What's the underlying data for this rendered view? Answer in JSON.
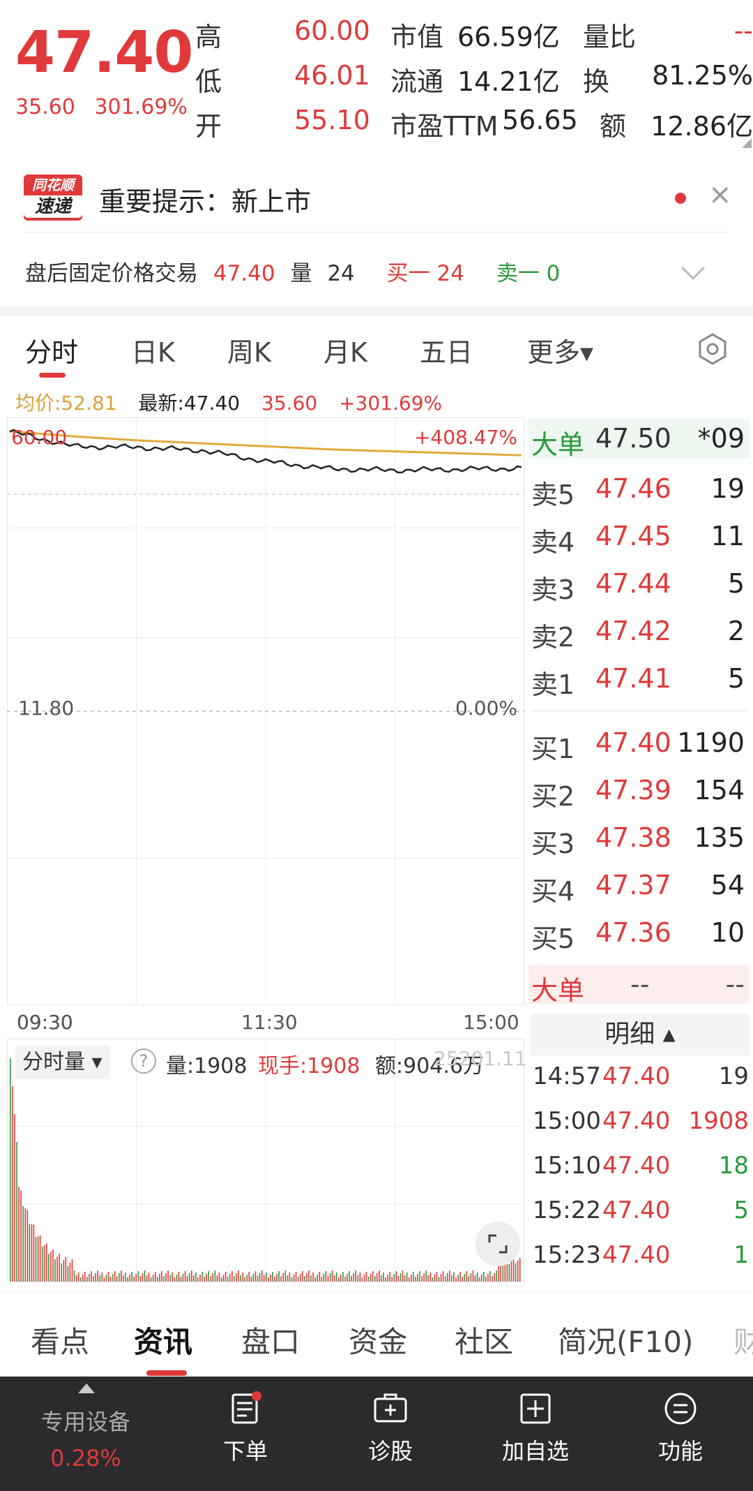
{
  "quote": {
    "price": "47.40",
    "change": "35.60",
    "change_pct": "301.69%",
    "rows": [
      {
        "l1": "高",
        "v1": "60.00",
        "l2": "市值",
        "v2": "66.59亿",
        "l3": "量比",
        "v3": "--"
      },
      {
        "l1": "低",
        "v1": "46.01",
        "l2": "流通",
        "v2": "14.21亿",
        "l3": "换",
        "v3": "81.25%"
      },
      {
        "l1": "开",
        "v1": "55.10",
        "l2": "市盈TTM",
        "v2": "56.65",
        "l3": "额",
        "v3": "12.86亿"
      }
    ]
  },
  "notice": {
    "logo_top": "同花顺",
    "logo_bottom": "速递",
    "text": "重要提示：新上市"
  },
  "after_hours": {
    "label": "盘后固定价格交易",
    "price": "47.40",
    "vol_label": "量",
    "vol": "24",
    "buy1": "买一 24",
    "sell1": "卖一 0"
  },
  "tabs": [
    "分时",
    "日K",
    "周K",
    "月K",
    "五日",
    "更多▾"
  ],
  "stats": {
    "avg": "均价:52.81",
    "latest": "最新:47.40",
    "change": "35.60",
    "pct": "+301.69%"
  },
  "chart_labels": {
    "top_left": "60.00",
    "top_right": "+408.47%",
    "mid_left": "11.80",
    "mid_right": "0.00%",
    "t_start": "09:30",
    "t_mid": "11:30",
    "t_end": "15:00"
  },
  "colors": {
    "red": "#e0393a",
    "green": "#2a9a3a",
    "avg_line": "#e2a93a"
  },
  "chart_data": {
    "type": "line",
    "x": [
      "09:30",
      "10:00",
      "10:30",
      "11:00",
      "11:30",
      "13:30",
      "14:00",
      "14:30",
      "15:00"
    ],
    "series": [
      {
        "values": [
          60.0,
          57.0,
          56.8,
          56.2,
          54.0,
          52.5,
          52.2,
          52.4,
          52.6
        ]
      },
      {
        "values": [
          60.0,
          59.0,
          58.2,
          57.6,
          57.0,
          56.4,
          56.0,
          55.6,
          55.2
        ]
      }
    ],
    "ylim": [
      11.8,
      60.0
    ]
  },
  "order_book": {
    "big_top": {
      "label": "大单",
      "price": "47.50",
      "qty": "*09"
    },
    "asks": [
      {
        "label": "卖5",
        "price": "47.46",
        "qty": "19"
      },
      {
        "label": "卖4",
        "price": "47.45",
        "qty": "11"
      },
      {
        "label": "卖3",
        "price": "47.44",
        "qty": "5"
      },
      {
        "label": "卖2",
        "price": "47.42",
        "qty": "2"
      },
      {
        "label": "卖1",
        "price": "47.41",
        "qty": "5"
      }
    ],
    "bids": [
      {
        "label": "买1",
        "price": "47.40",
        "qty": "1190"
      },
      {
        "label": "买2",
        "price": "47.39",
        "qty": "154"
      },
      {
        "label": "买3",
        "price": "47.38",
        "qty": "135"
      },
      {
        "label": "买4",
        "price": "47.37",
        "qty": "54"
      },
      {
        "label": "买5",
        "price": "47.36",
        "qty": "10"
      }
    ],
    "big_bottom": {
      "label": "大单",
      "price": "--",
      "qty": "--"
    },
    "detail_label": "明细 ▴"
  },
  "volume": {
    "selector": "分时量 ▾",
    "help": "?",
    "qty": "量:1908",
    "now": "现手:1908",
    "amount": "额:904.6万",
    "right_label": "25201.11"
  },
  "ticks": [
    {
      "time": "14:57",
      "price": "47.40",
      "qty": "19",
      "side": "neutral"
    },
    {
      "time": "15:00",
      "price": "47.40",
      "qty": "1908",
      "side": "buy"
    },
    {
      "time": "15:10",
      "price": "47.40",
      "qty": "18",
      "side": "sell"
    },
    {
      "time": "15:22",
      "price": "47.40",
      "qty": "5",
      "side": "sell"
    },
    {
      "time": "15:23",
      "price": "47.40",
      "qty": "1",
      "side": "sell"
    }
  ],
  "info_tabs": [
    "看点",
    "资讯",
    "盘口",
    "资金",
    "社区",
    "简况(F10)",
    "财"
  ],
  "bottom_bar": {
    "device": "专用设备",
    "device_pct": "0.28%",
    "items": [
      "下单",
      "诊股",
      "加自选",
      "功能"
    ]
  }
}
